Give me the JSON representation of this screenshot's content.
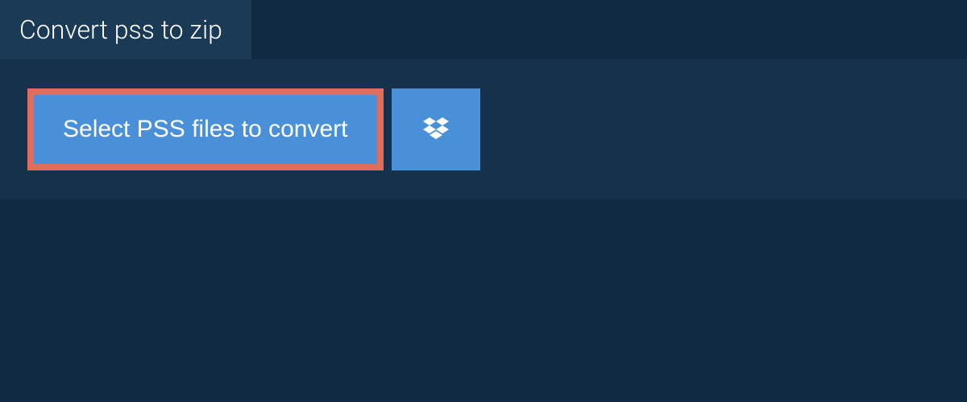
{
  "tab": {
    "title": "Convert pss to zip"
  },
  "actions": {
    "select_label": "Select PSS files to convert"
  },
  "colors": {
    "background": "#102a43",
    "panel": "#16314b",
    "tab": "#1a3a56",
    "button": "#4a90d9",
    "highlight_border": "#e06c5c"
  }
}
